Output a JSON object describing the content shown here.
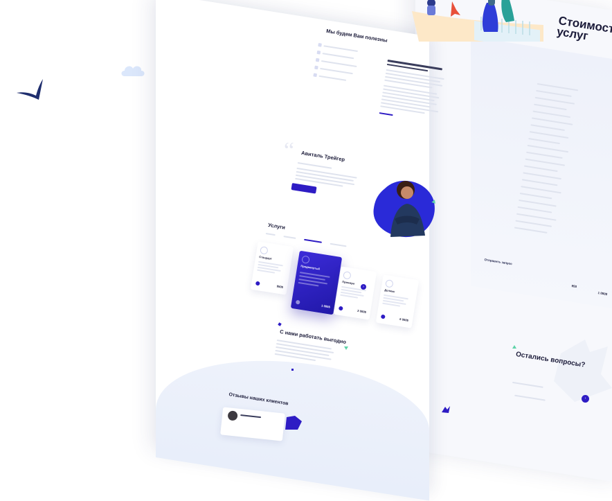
{
  "colors": {
    "brand": "#2e1cc4",
    "accent_green": "#5fd3a8",
    "cloud": "#dbe7fb"
  },
  "sections": {
    "useful_title": "Мы будем Вам полезны",
    "list_items": [
      "",
      "",
      "",
      "",
      ""
    ],
    "person_name": "Авиталь Трейгер",
    "services_title": "Услуги",
    "benefit_title": "С нами работать выгодно",
    "reviews_title": "Отзывы наших клиентов",
    "pricing_title": "Стоимость услуг",
    "questions_title": "Остались вопросы?",
    "send_request": "Отправить запрос"
  },
  "plans": [
    {
      "name": "Стандарт",
      "price": "950$"
    },
    {
      "name": "Продвинутый",
      "price": "1 000$"
    },
    {
      "name": "Премиум",
      "price": "2 000$"
    },
    {
      "name": "Делюкс",
      "price": "6 000$"
    }
  ],
  "right_prices": [
    "950",
    "1 000$"
  ],
  "icons": [
    "bird-logo-icon",
    "cloud-icon",
    "quote-icon",
    "heart-icon",
    "arrow-right-icon",
    "triangle-icon"
  ]
}
